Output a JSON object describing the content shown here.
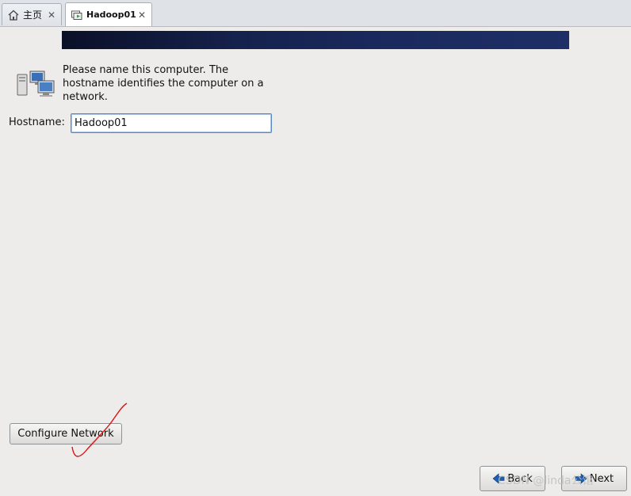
{
  "tabs": [
    {
      "label": "主页",
      "icon": "home-icon"
    },
    {
      "label": "Hadoop01",
      "icon": "vm-icon"
    }
  ],
  "colors": {
    "banner": "#15224d",
    "input_border": "#5b87c2",
    "annotation": "#e01010"
  },
  "description": "Please name this computer.  The\nhostname identifies the computer on a\nnetwork.",
  "hostname": {
    "label": "Hostname:",
    "value": "Hadoop01"
  },
  "buttons": {
    "configure_network": "Configure Network",
    "back": "Back",
    "next": "Next"
  },
  "watermark": "CSDN @linda公馆"
}
